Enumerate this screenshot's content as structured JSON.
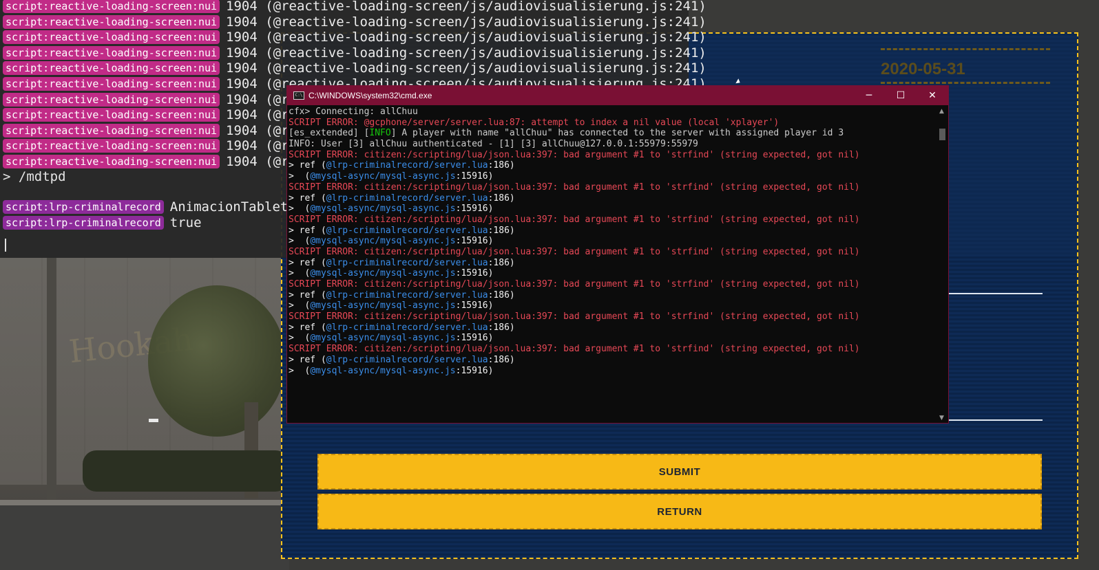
{
  "console": {
    "log_lines": [
      {
        "tag": "script:reactive-loading-screen:nui",
        "msg": "1904 (@reactive-loading-screen/js/audiovisualisierung.js:241)"
      },
      {
        "tag": "script:reactive-loading-screen:nui",
        "msg": "1904 (@reactive-loading-screen/js/audiovisualisierung.js:241)"
      },
      {
        "tag": "script:reactive-loading-screen:nui",
        "msg": "1904 (@reactive-loading-screen/js/audiovisualisierung.js:241)"
      },
      {
        "tag": "script:reactive-loading-screen:nui",
        "msg": "1904 (@reactive-loading-screen/js/audiovisualisierung.js:241)"
      },
      {
        "tag": "script:reactive-loading-screen:nui",
        "msg": "1904 (@reactive-loading-screen/js/audiovisualisierung.js:241)"
      },
      {
        "tag": "script:reactive-loading-screen:nui",
        "msg": "1904 (@reactive-loading-screen/js/audiovisualisierung.js:241)"
      },
      {
        "tag": "script:reactive-loading-screen:nui",
        "msg": "1904 (@r"
      },
      {
        "tag": "script:reactive-loading-screen:nui",
        "msg": "1904 (@r"
      },
      {
        "tag": "script:reactive-loading-screen:nui",
        "msg": "1904 (@r"
      },
      {
        "tag": "script:reactive-loading-screen:nui",
        "msg": "1904 (@r"
      },
      {
        "tag": "script:reactive-loading-screen:nui",
        "msg": "1904 (@r"
      }
    ],
    "prompt_text": "> /mdtpd",
    "lrp_lines": [
      {
        "tag": "script:lrp-criminalrecord",
        "msg": "AnimacionTablet"
      },
      {
        "tag": "script:lrp-criminalrecord",
        "msg": "true"
      }
    ],
    "input_value": ""
  },
  "scene": {
    "sign_text": "Hookah"
  },
  "panel": {
    "title": "",
    "date": "2020-05-31",
    "submit_label": "SUBMIT",
    "return_label": "RETURN"
  },
  "cmd": {
    "title": "C:\\WINDOWS\\system32\\cmd.exe",
    "icon_text": "C:\\",
    "minimize_glyph": "─",
    "maximize_glyph": "☐",
    "close_glyph": "✕",
    "lines": [
      [
        {
          "t": "cfx> Connecting: allChuu",
          "c": "gray"
        }
      ],
      [
        {
          "t": "SCRIPT ERROR: @gcphone/server/server.lua:87: attempt to index a nil value (local 'xplayer')",
          "c": "red"
        }
      ],
      [
        {
          "t": "[es_extended] [",
          "c": "gray"
        },
        {
          "t": "INFO",
          "c": "green"
        },
        {
          "t": "] A player with name \"allChuu\" has connected to the server with assigned player id 3",
          "c": "gray"
        }
      ],
      [
        {
          "t": "INFO: User [3] allChuu authenticated - [1] [3] allChuu@127.0.0.1:55979:55979",
          "c": "gray"
        }
      ],
      [
        {
          "t": "SCRIPT ERROR: citizen:/scripting/lua/json.lua:397: bad argument #1 to 'strfind' (string expected, got nil)",
          "c": "red"
        }
      ],
      [
        {
          "t": "> ref (",
          "c": "white"
        },
        {
          "t": "@lrp-criminalrecord/server.lua",
          "c": "blue"
        },
        {
          "t": ":186)",
          "c": "white"
        }
      ],
      [
        {
          "t": ">  (",
          "c": "white"
        },
        {
          "t": "@mysql-async/mysql-async.js",
          "c": "blue"
        },
        {
          "t": ":15916)",
          "c": "white"
        }
      ],
      [
        {
          "t": "SCRIPT ERROR: citizen:/scripting/lua/json.lua:397: bad argument #1 to 'strfind' (string expected, got nil)",
          "c": "red"
        }
      ],
      [
        {
          "t": "> ref (",
          "c": "white"
        },
        {
          "t": "@lrp-criminalrecord/server.lua",
          "c": "blue"
        },
        {
          "t": ":186)",
          "c": "white"
        }
      ],
      [
        {
          "t": ">  (",
          "c": "white"
        },
        {
          "t": "@mysql-async/mysql-async.js",
          "c": "blue"
        },
        {
          "t": ":15916)",
          "c": "white"
        }
      ],
      [
        {
          "t": "SCRIPT ERROR: citizen:/scripting/lua/json.lua:397: bad argument #1 to 'strfind' (string expected, got nil)",
          "c": "red"
        }
      ],
      [
        {
          "t": "> ref (",
          "c": "white"
        },
        {
          "t": "@lrp-criminalrecord/server.lua",
          "c": "blue"
        },
        {
          "t": ":186)",
          "c": "white"
        }
      ],
      [
        {
          "t": ">  (",
          "c": "white"
        },
        {
          "t": "@mysql-async/mysql-async.js",
          "c": "blue"
        },
        {
          "t": ":15916)",
          "c": "white"
        }
      ],
      [
        {
          "t": "SCRIPT ERROR: citizen:/scripting/lua/json.lua:397: bad argument #1 to 'strfind' (string expected, got nil)",
          "c": "red"
        }
      ],
      [
        {
          "t": "> ref (",
          "c": "white"
        },
        {
          "t": "@lrp-criminalrecord/server.lua",
          "c": "blue"
        },
        {
          "t": ":186)",
          "c": "white"
        }
      ],
      [
        {
          "t": ">  (",
          "c": "white"
        },
        {
          "t": "@mysql-async/mysql-async.js",
          "c": "blue"
        },
        {
          "t": ":15916)",
          "c": "white"
        }
      ],
      [
        {
          "t": "SCRIPT ERROR: citizen:/scripting/lua/json.lua:397: bad argument #1 to 'strfind' (string expected, got nil)",
          "c": "red"
        }
      ],
      [
        {
          "t": "> ref (",
          "c": "white"
        },
        {
          "t": "@lrp-criminalrecord/server.lua",
          "c": "blue"
        },
        {
          "t": ":186)",
          "c": "white"
        }
      ],
      [
        {
          "t": ">  (",
          "c": "white"
        },
        {
          "t": "@mysql-async/mysql-async.js",
          "c": "blue"
        },
        {
          "t": ":15916)",
          "c": "white"
        }
      ],
      [
        {
          "t": "SCRIPT ERROR: citizen:/scripting/lua/json.lua:397: bad argument #1 to 'strfind' (string expected, got nil)",
          "c": "red"
        }
      ],
      [
        {
          "t": "> ref (",
          "c": "white"
        },
        {
          "t": "@lrp-criminalrecord/server.lua",
          "c": "blue"
        },
        {
          "t": ":186)",
          "c": "white"
        }
      ],
      [
        {
          "t": ">  (",
          "c": "white"
        },
        {
          "t": "@mysql-async/mysql-async.js",
          "c": "blue"
        },
        {
          "t": ":15916)",
          "c": "white"
        }
      ],
      [
        {
          "t": "SCRIPT ERROR: citizen:/scripting/lua/json.lua:397: bad argument #1 to 'strfind' (string expected, got nil)",
          "c": "red"
        }
      ],
      [
        {
          "t": "> ref (",
          "c": "white"
        },
        {
          "t": "@lrp-criminalrecord/server.lua",
          "c": "blue"
        },
        {
          "t": ":186)",
          "c": "white"
        }
      ],
      [
        {
          "t": ">  (",
          "c": "white"
        },
        {
          "t": "@mysql-async/mysql-async.js",
          "c": "blue"
        },
        {
          "t": ":15916)",
          "c": "white"
        }
      ]
    ]
  },
  "colors": {
    "tag_pink": "#c12b87",
    "tag_purple": "#8d2b9a",
    "cmd_titlebar": "#7a1034",
    "panel_button": "#f7b916",
    "panel_border": "#f7c21d",
    "error_red": "#e74856",
    "link_blue": "#3b8eea",
    "info_green": "#16c60c"
  },
  "icons": [
    "cmd-app-icon",
    "minimize-icon",
    "maximize-icon",
    "close-icon",
    "scroll-up-icon",
    "scroll-down-icon",
    "mouse-cursor-icon"
  ]
}
